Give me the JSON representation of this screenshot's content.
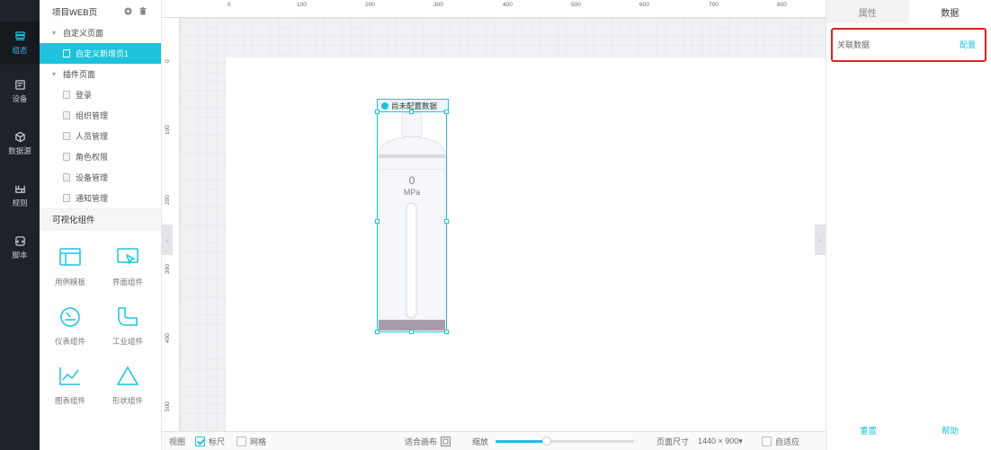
{
  "rail": {
    "items": [
      {
        "label": "组态",
        "icon": "layers-icon"
      },
      {
        "label": "设备",
        "icon": "device-icon"
      },
      {
        "label": "数据源",
        "icon": "cube-icon"
      },
      {
        "label": "规则",
        "icon": "rule-icon"
      },
      {
        "label": "脚本",
        "icon": "script-icon"
      }
    ]
  },
  "left": {
    "project_title": "项目WEB页",
    "custom_group": "自定义页面",
    "custom_pages": [
      "自定义新增页1"
    ],
    "plugin_group": "插件页面",
    "plugin_pages": [
      "登录",
      "组织管理",
      "人员管理",
      "角色权限",
      "设备管理",
      "通知管理"
    ],
    "components_title": "可视化组件",
    "components": [
      {
        "label": "用例模板",
        "icon": "template-icon"
      },
      {
        "label": "界面组件",
        "icon": "cursor-window-icon"
      },
      {
        "label": "仪表组件",
        "icon": "gauge-icon"
      },
      {
        "label": "工业组件",
        "icon": "pipe-icon"
      },
      {
        "label": "图表组件",
        "icon": "line-chart-icon"
      },
      {
        "label": "形状组件",
        "icon": "triangle-icon"
      }
    ]
  },
  "ruler": {
    "top": [
      "0",
      "100",
      "200",
      "300",
      "400",
      "500",
      "600",
      "700",
      "800"
    ],
    "left": [
      "0",
      "100",
      "200",
      "300",
      "400",
      "500"
    ]
  },
  "widget": {
    "status": "尚未配置数据",
    "value": "0",
    "unit": "MPa"
  },
  "bottom": {
    "view_label": "视图",
    "ruler_label": "标尺",
    "ruler_checked": true,
    "grid_label": "网格",
    "grid_checked": false,
    "fit_label": "适合画布",
    "zoom_label": "缩放",
    "zoom_level": 0.37,
    "page_size_label": "页面尺寸",
    "page_size_value": "1440 × 900▾",
    "auto_fit_label": "自适应"
  },
  "right": {
    "tabs": [
      "属性",
      "数据"
    ],
    "active_tab": 1,
    "related_label": "关联数据",
    "configure_link": "配置",
    "reset_label": "重置",
    "help_label": "帮助"
  },
  "colors": {
    "accent": "#1ec2dd",
    "rail_bg": "#1f2329",
    "highlight_border": "#e02020"
  }
}
